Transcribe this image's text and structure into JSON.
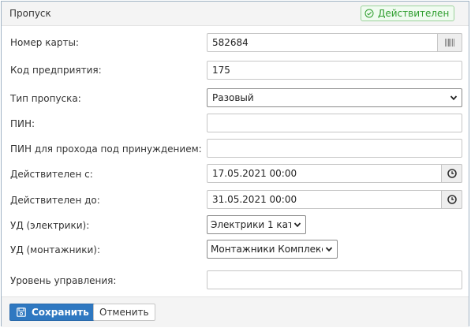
{
  "header": {
    "title": "Пропуск",
    "status": "Действителен"
  },
  "colors": {
    "accent": "#2f78c1",
    "status_ok": "#2e9e2e",
    "border": "#9fb2c4"
  },
  "fields": {
    "card_number": {
      "label": "Номер карты:",
      "value": "582684",
      "icon": "barcode-icon"
    },
    "company_code": {
      "label": "Код предприятия:",
      "value": "175"
    },
    "pass_type": {
      "label": "Тип пропуска:",
      "value": "Разовый"
    },
    "pin": {
      "label": "ПИН:",
      "value": ""
    },
    "duress_pin": {
      "label": "ПИН для прохода под принуждением:",
      "value": ""
    },
    "valid_from": {
      "label": "Действителен с:",
      "value": "17.05.2021 00:00",
      "icon": "clock-icon"
    },
    "valid_to": {
      "label": "Действителен до:",
      "value": "31.05.2021 00:00",
      "icon": "clock-icon"
    },
    "ud_electric": {
      "label": "УД (электрики):",
      "value": "Электрики 1 кат"
    },
    "ud_mount": {
      "label": "УД (монтажники):",
      "value": "Монтажники Комплекс"
    },
    "control_level": {
      "label": "Уровень управления:",
      "value": ""
    }
  },
  "footer": {
    "save_label": "Сохранить",
    "cancel_label": "Отменить"
  }
}
